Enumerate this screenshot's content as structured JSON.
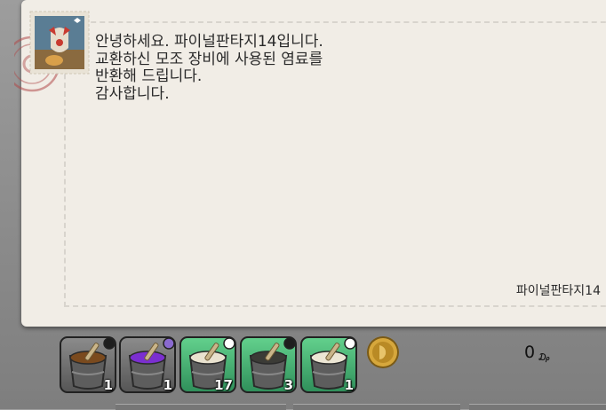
{
  "letter": {
    "body_lines": [
      "안녕하세요. 파이널판타지14입니다.",
      "교환하신 모조 장비에 사용된 염료를",
      "반환해 드립니다.",
      "감사합니다."
    ],
    "signature": "파이널판타지14"
  },
  "attachments": {
    "items": [
      {
        "icon": "brown-dye-icon",
        "color": "#7a4a1e",
        "tint": "#1e1e1e",
        "quantity": "1",
        "selected": false
      },
      {
        "icon": "purple-dye-icon",
        "color": "#7b2fd0",
        "tint": "#8a6ad0",
        "quantity": "1",
        "selected": false
      },
      {
        "icon": "white-dye-icon",
        "color": "#e9e2cf",
        "tint": "#ffffff",
        "quantity": "17",
        "selected": true
      },
      {
        "icon": "black-dye-icon",
        "color": "#3b3b36",
        "tint": "#1e1e1e",
        "quantity": "3",
        "selected": true
      },
      {
        "icon": "white-dye-icon",
        "color": "#ece6d4",
        "tint": "#ffffff",
        "quantity": "1",
        "selected": true
      }
    ],
    "gil_amount": "0",
    "gil_symbol": "₯"
  }
}
